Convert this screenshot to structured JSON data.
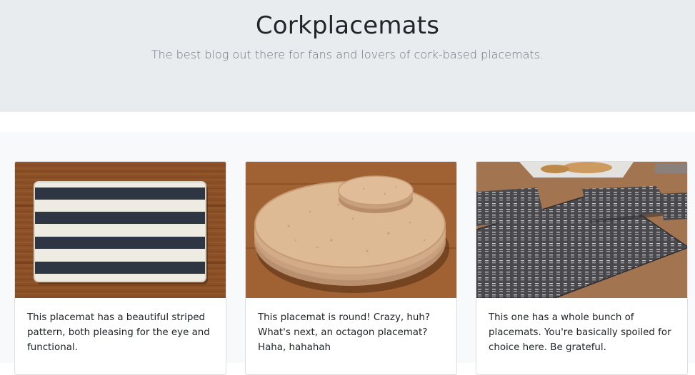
{
  "hero": {
    "title": "Corkplacemats",
    "lead": "The best blog out there for fans and lovers of cork-based placemats."
  },
  "cards": [
    {
      "image": "striped-placemat-photo",
      "text": "This placemat has a beautiful striped pattern, both pleasing for the eye and functional."
    },
    {
      "image": "round-cork-placemat-photo",
      "text": "This placemat is round! Crazy, huh? What's next, an octagon placemat? Haha, hahahah"
    },
    {
      "image": "patterned-placemat-set-photo",
      "text": "This one has a whole bunch of placemats. You're basically spoiled for choice here. Be grateful."
    }
  ],
  "colors": {
    "hero_background": "#e9ecef",
    "album_background": "#f8f9fa",
    "lead_text": "#6c757d",
    "heading_text": "#212529"
  }
}
